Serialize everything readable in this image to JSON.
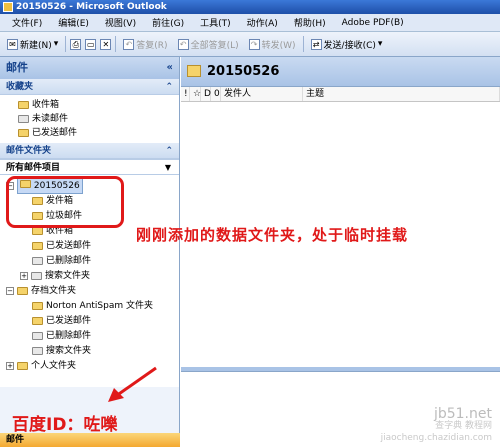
{
  "window": {
    "title": "20150526 - Microsoft Outlook"
  },
  "menu": [
    "文件(F)",
    "编辑(E)",
    "视图(V)",
    "前往(G)",
    "工具(T)",
    "动作(A)",
    "帮助(H)",
    "Adobe PDF(B)"
  ],
  "toolbar": {
    "new": "新建(N)",
    "reply": "答复(R)",
    "reply_all": "全部答复(L)",
    "forward": "转发(W)",
    "send_receive": "发送/接收(C)"
  },
  "nav": {
    "title": "邮件",
    "collapse": "«",
    "favorites_header": "收藏夹",
    "favorites": [
      "收件箱",
      "未读邮件",
      "已发送邮件"
    ],
    "mail_folders_header": "邮件文件夹",
    "all_items": "所有邮件项目",
    "tree": {
      "new_file": "20150526",
      "folders_1": [
        "发件箱",
        "垃圾邮件",
        "收件箱",
        "已发送邮件",
        "已删除邮件",
        "搜索文件夹"
      ],
      "archive": "存档文件夹",
      "folders_2": [
        "Norton AntiSpam 文件夹",
        "已发送邮件",
        "已删除邮件",
        "搜索文件夹"
      ],
      "personal": "个人文件夹"
    },
    "mail_button": "邮件"
  },
  "content": {
    "folder_title": "20150526",
    "columns": [
      "!",
      "☆",
      "D",
      "0",
      "发件人",
      "主题"
    ]
  },
  "annotations": {
    "note": "刚刚添加的数据文件夹，处于临时挂载",
    "baidu": "百度ID：咗嚛",
    "watermark_site": "jb51.net",
    "watermark_tutorial": "查字典 教程网",
    "watermark_url": "jiaocheng.chazidian.com"
  }
}
